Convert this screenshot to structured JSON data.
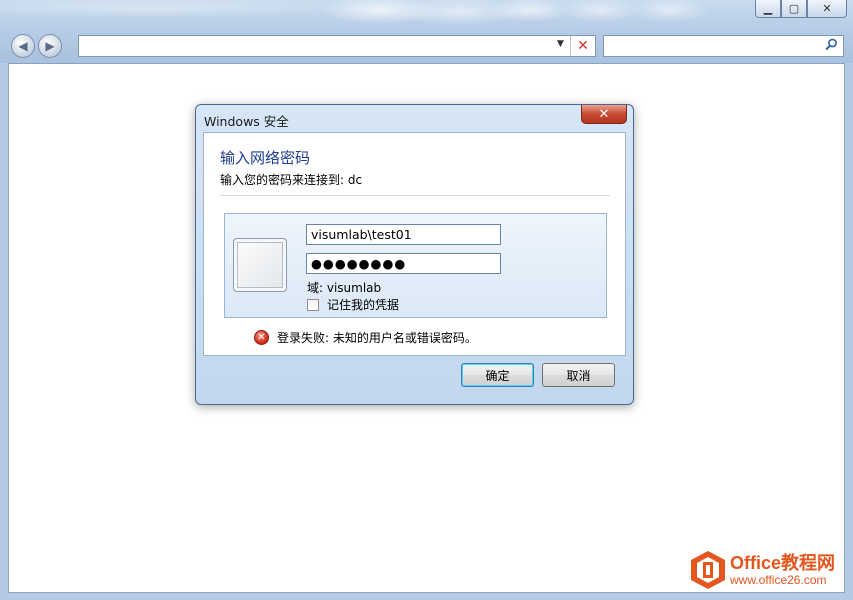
{
  "browser": {
    "address_value": "",
    "search_value": ""
  },
  "dialog": {
    "title": "Windows 安全",
    "heading": "输入网络密码",
    "subtitle": "输入您的密码来连接到: dc",
    "username_value": "visumlab\\test01",
    "password_value": "●●●●●●●●",
    "domain_label": "域: visumlab",
    "remember_label": "记住我的凭据",
    "remember_checked": false,
    "error_text": "登录失败: 未知的用户名或错误密码。",
    "ok_label": "确定",
    "cancel_label": "取消"
  },
  "watermark": {
    "brand": "Office教程网",
    "url": "www.office26.com"
  },
  "icons": {
    "back": "back-arrow-icon",
    "forward": "forward-arrow-icon",
    "stop": "stop-x-icon",
    "search": "magnifier-icon",
    "error": "error-x-icon",
    "user": "user-tile-icon",
    "office": "office-logo-icon"
  },
  "colors": {
    "heading": "#1e3d8f",
    "close_button": "#c74a36",
    "watermark": "#e5561f"
  }
}
